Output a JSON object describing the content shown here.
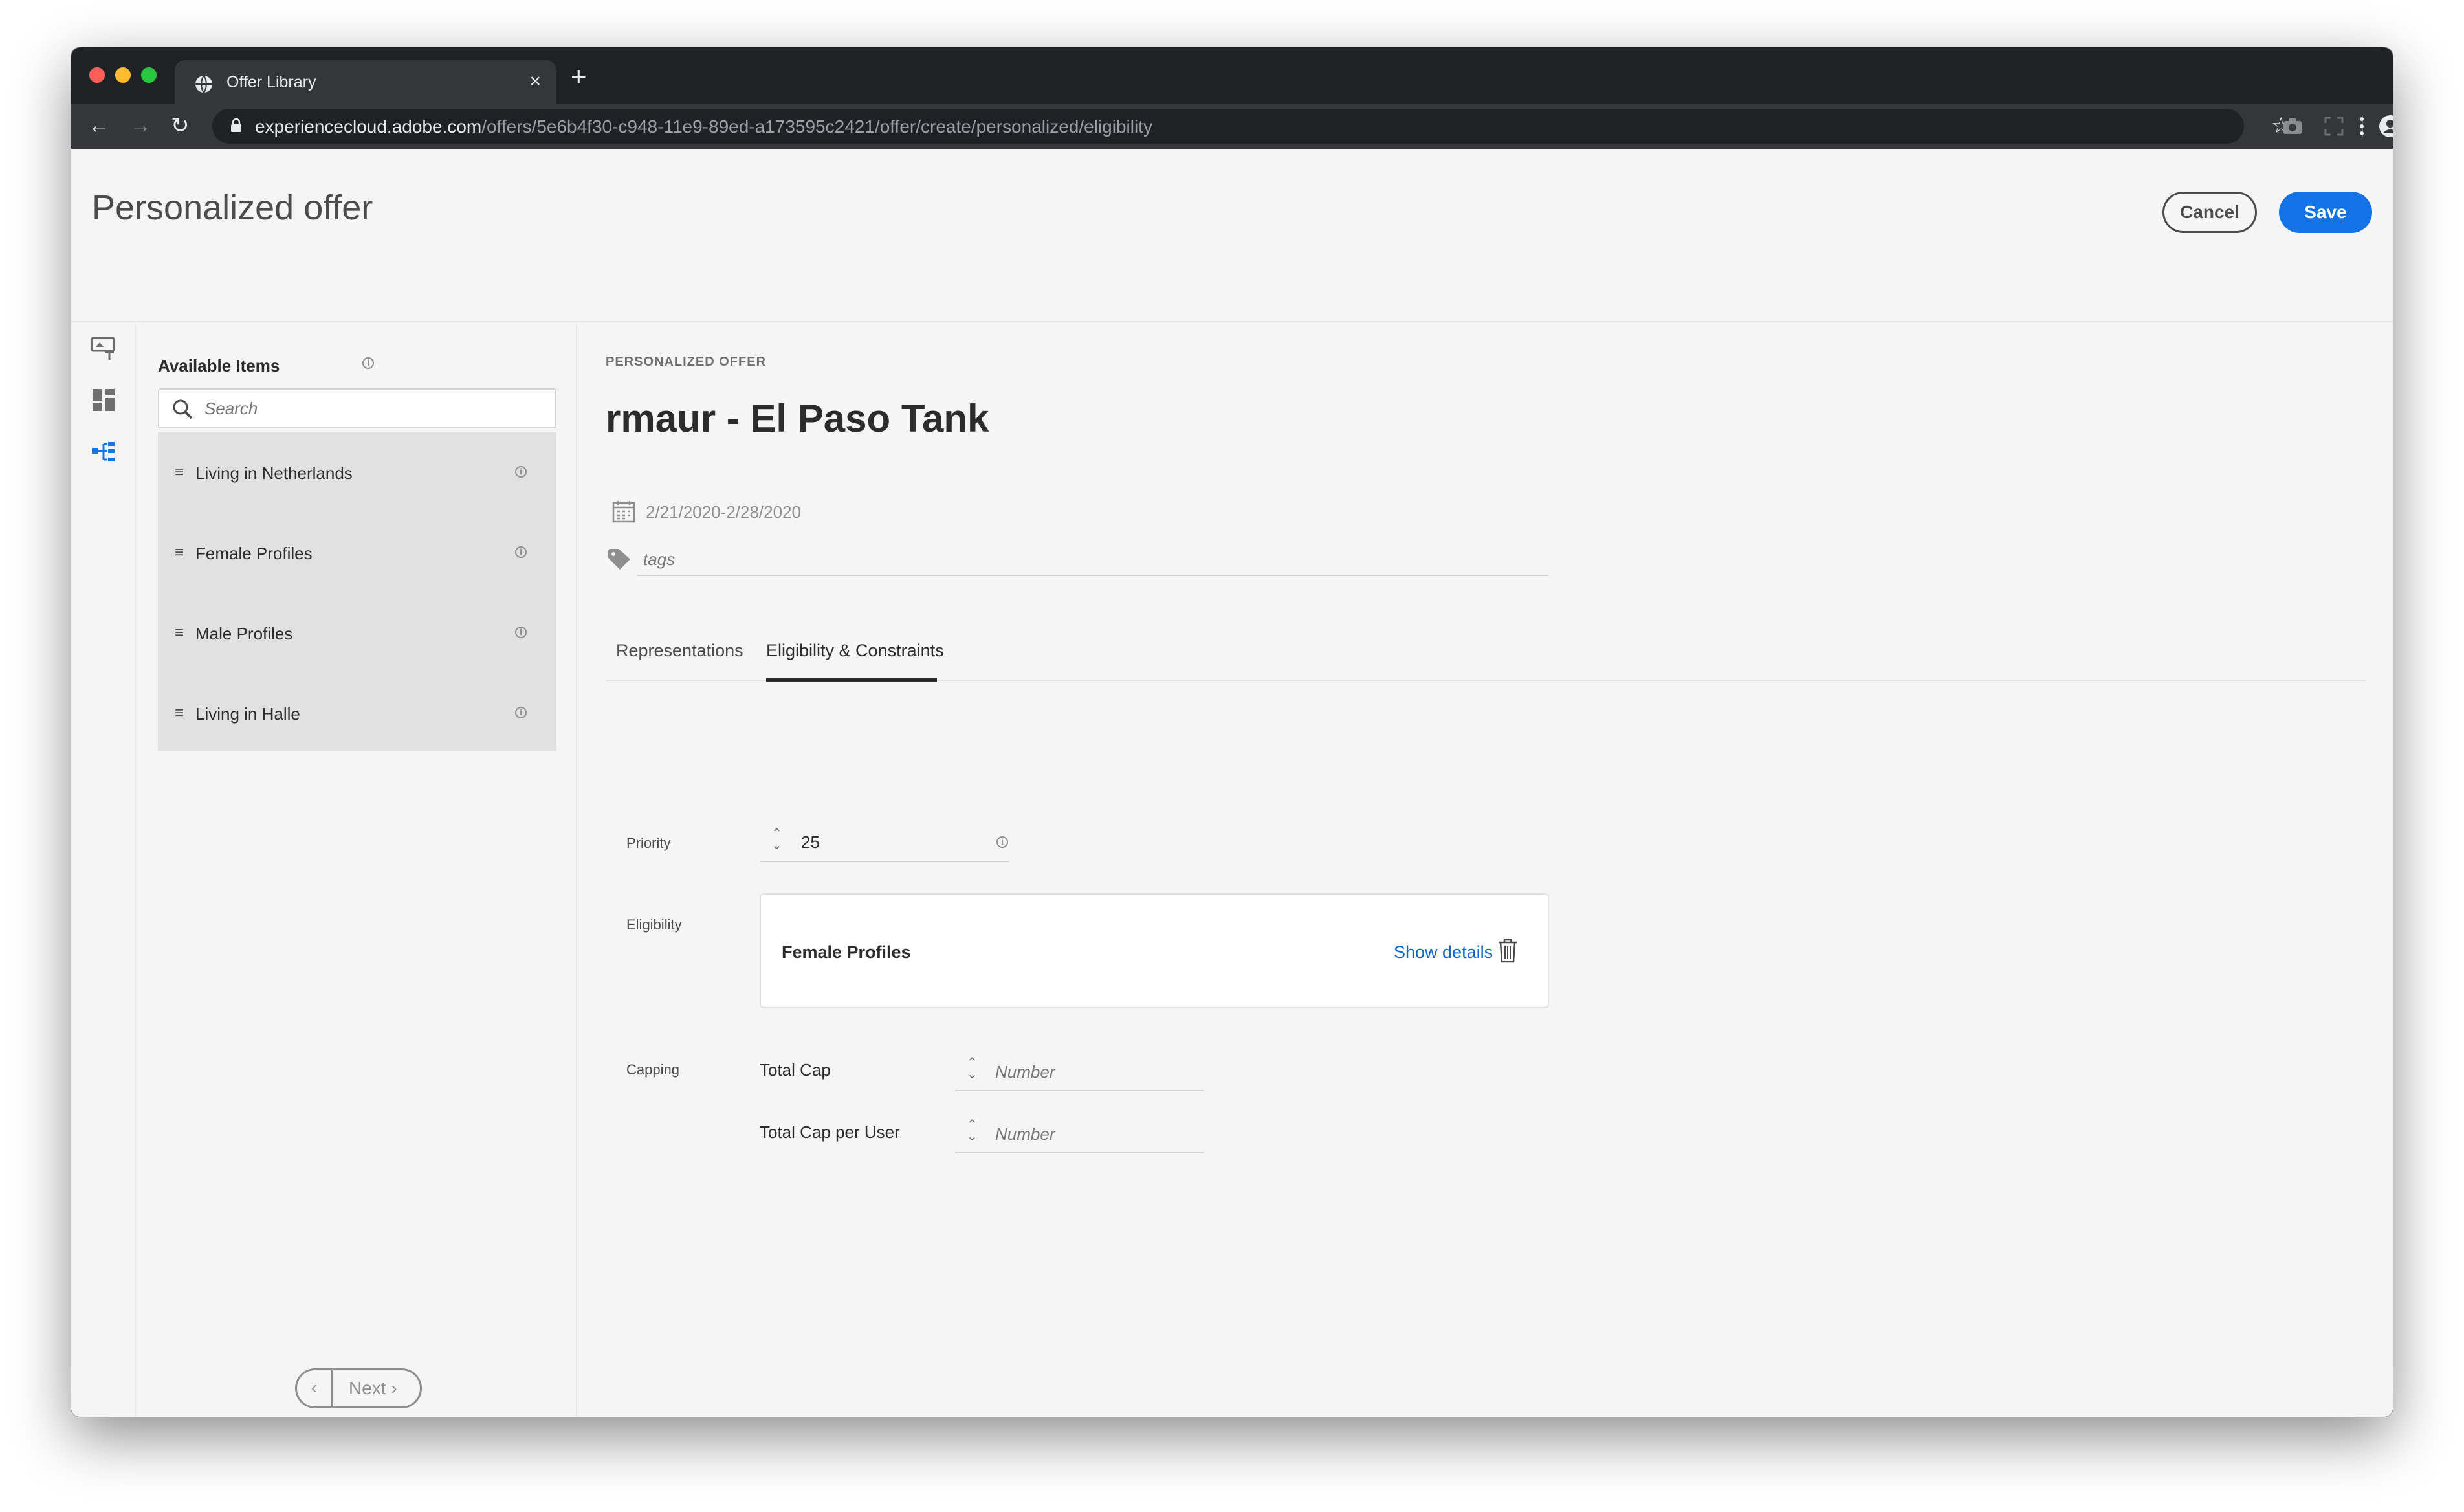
{
  "browser": {
    "tab_title": "Offer Library",
    "tab_close": "×",
    "new_tab": "+",
    "url_host": "experiencecloud.adobe.com",
    "url_path": "/offers/5e6b4f30-c948-11e9-89ed-a173595c2421/offer/create/personalized/eligibility",
    "icons": [
      "back-icon",
      "forward-icon",
      "reload-icon",
      "lock-icon",
      "star-icon",
      "camera-icon",
      "fullscreen-icon",
      "profile-icon",
      "menu-icon"
    ]
  },
  "header": {
    "title": "Personalized offer",
    "cancel_label": "Cancel",
    "save_label": "Save"
  },
  "rail": {
    "icons": [
      "offer-content-icon",
      "components-icon",
      "hierarchy-icon"
    ],
    "active": "hierarchy-icon"
  },
  "left_panel": {
    "title": "Available Items",
    "info_glyph": "i",
    "search_placeholder": "Search",
    "items": [
      {
        "label": "Living in Netherlands"
      },
      {
        "label": "Female Profiles"
      },
      {
        "label": "Male Profiles"
      },
      {
        "label": "Living in Halle"
      }
    ],
    "drag_glyph": "≡",
    "prev_glyph": "‹",
    "next_label": "Next ›"
  },
  "main": {
    "eyebrow": "PERSONALIZED OFFER",
    "offer_title": "rmaur - El Paso Tank",
    "date_range": "2/21/2020-2/28/2020",
    "tags_placeholder": "tags",
    "tabs": [
      {
        "label": "Representations",
        "active": false
      },
      {
        "label": "Eligibility & Constraints",
        "active": true
      }
    ],
    "priority": {
      "label": "Priority",
      "value": "25"
    },
    "eligibility": {
      "label": "Eligibility",
      "selected": "Female Profiles",
      "show_details": "Show details"
    },
    "capping": {
      "label": "Capping",
      "total_cap_label": "Total Cap",
      "total_cap_placeholder": "Number",
      "per_user_label": "Total Cap per User",
      "per_user_placeholder": "Number"
    }
  },
  "colors": {
    "accent": "#1473e6",
    "link": "#0d66d0",
    "chrome_dark": "#202124",
    "chrome_toolbar": "#35363a"
  }
}
